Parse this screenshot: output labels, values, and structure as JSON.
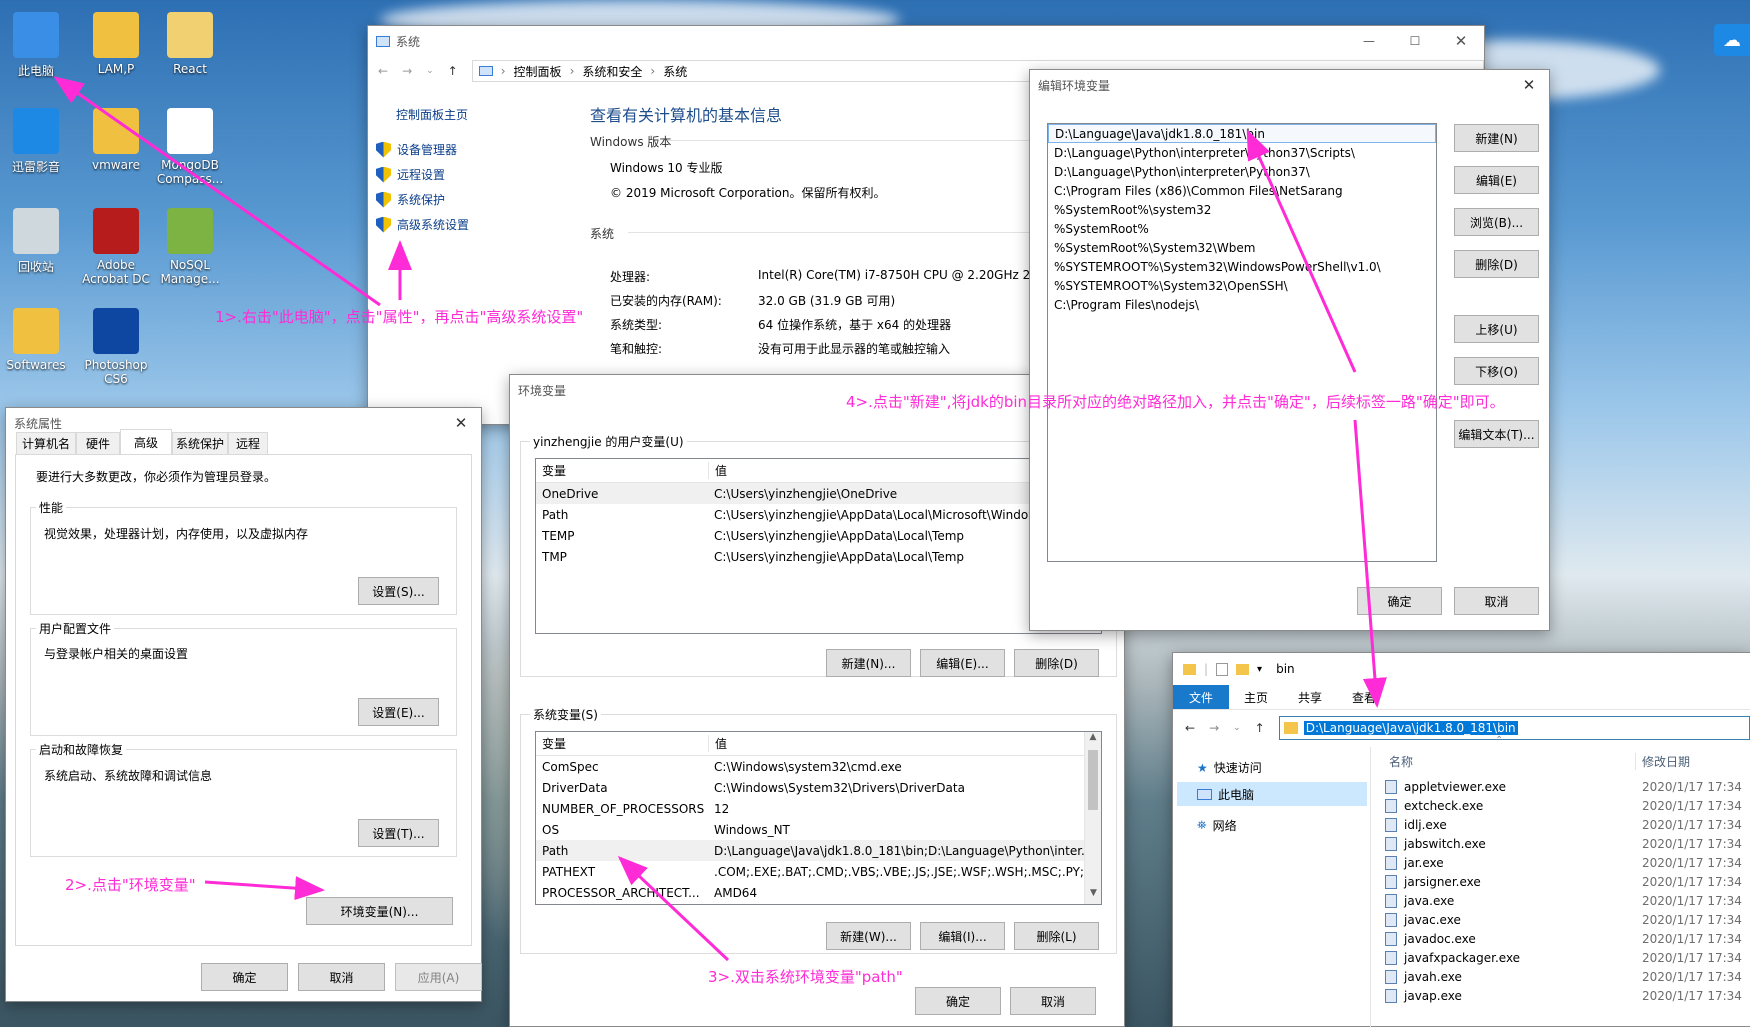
{
  "desktop": {
    "icons": [
      {
        "label": "此电脑",
        "color": "#3a8ee6"
      },
      {
        "label": "LAM,P",
        "color": "#f0c040"
      },
      {
        "label": "React",
        "color": "#f0d070"
      },
      {
        "label": "迅雷影音",
        "color": "#1e88e5"
      },
      {
        "label": "vmware",
        "color": "#f0c040"
      },
      {
        "label": "MongoDB Compass...",
        "color": "#ffffff"
      },
      {
        "label": "回收站",
        "color": "#cfd8dc"
      },
      {
        "label": "Adobe Acrobat DC",
        "color": "#b71c1c"
      },
      {
        "label": "NoSQL Manage...",
        "color": "#7cb342"
      },
      {
        "label": "Softwares",
        "color": "#f0c040"
      },
      {
        "label": "Photoshop CS6",
        "color": "#0d47a1"
      }
    ]
  },
  "system_window": {
    "title": "系统",
    "breadcrumb": [
      "控制面板",
      "系统和安全",
      "系统"
    ],
    "side_title": "控制面板主页",
    "side_links": [
      "设备管理器",
      "远程设置",
      "系统保护",
      "高级系统设置"
    ],
    "heading": "查看有关计算机的基本信息",
    "edition_label": "Windows 版本",
    "edition": "Windows 10 专业版",
    "copyright": "© 2019 Microsoft Corporation。保留所有权利。",
    "system_label": "系统",
    "rows": [
      {
        "k": "处理器:",
        "v": "Intel(R) Core(TM) i7-8750H CPU @ 2.20GHz   2"
      },
      {
        "k": "已安装的内存(RAM):",
        "v": "32.0 GB (31.9 GB 可用)"
      },
      {
        "k": "系统类型:",
        "v": "64 位操作系统，基于 x64 的处理器"
      },
      {
        "k": "笔和触控:",
        "v": "没有可用于此显示器的笔或触控输入"
      }
    ]
  },
  "sysprops": {
    "title": "系统属性",
    "tabs": [
      "计算机名",
      "硬件",
      "高级",
      "系统保护",
      "远程"
    ],
    "admin_note": "要进行大多数更改，你必须作为管理员登录。",
    "perf_label": "性能",
    "perf_desc": "视觉效果，处理器计划，内存使用，以及虚拟内存",
    "perf_btn": "设置(S)...",
    "profile_label": "用户配置文件",
    "profile_desc": "与登录帐户相关的桌面设置",
    "profile_btn": "设置(E)...",
    "startup_label": "启动和故障恢复",
    "startup_desc": "系统启动、系统故障和调试信息",
    "startup_btn": "设置(T)...",
    "env_btn": "环境变量(N)...",
    "ok": "确定",
    "cancel": "取消",
    "apply": "应用(A)"
  },
  "envvars": {
    "title": "环境变量",
    "user_label": "yinzhengjie 的用户变量(U)",
    "col_var": "变量",
    "col_val": "值",
    "user_rows": [
      {
        "k": "OneDrive",
        "v": "C:\\Users\\yinzhengjie\\OneDrive"
      },
      {
        "k": "Path",
        "v": "C:\\Users\\yinzhengjie\\AppData\\Local\\Microsoft\\WindowsApps;"
      },
      {
        "k": "TEMP",
        "v": "C:\\Users\\yinzhengjie\\AppData\\Local\\Temp"
      },
      {
        "k": "TMP",
        "v": "C:\\Users\\yinzhengjie\\AppData\\Local\\Temp"
      }
    ],
    "user_new": "新建(N)...",
    "user_edit": "编辑(E)...",
    "user_del": "删除(D)",
    "sys_label": "系统变量(S)",
    "sys_rows": [
      {
        "k": "ComSpec",
        "v": "C:\\Windows\\system32\\cmd.exe"
      },
      {
        "k": "DriverData",
        "v": "C:\\Windows\\System32\\Drivers\\DriverData"
      },
      {
        "k": "NUMBER_OF_PROCESSORS",
        "v": "12"
      },
      {
        "k": "OS",
        "v": "Windows_NT"
      },
      {
        "k": "Path",
        "v": "D:\\Language\\Java\\jdk1.8.0_181\\bin;D:\\Language\\Python\\inter..."
      },
      {
        "k": "PATHEXT",
        "v": ".COM;.EXE;.BAT;.CMD;.VBS;.VBE;.JS;.JSE;.WSF;.WSH;.MSC;.PY;.P..."
      },
      {
        "k": "PROCESSOR_ARCHITECT...",
        "v": "AMD64"
      }
    ],
    "sys_new": "新建(W)...",
    "sys_edit": "编辑(I)...",
    "sys_del": "删除(L)",
    "ok": "确定",
    "cancel": "取消"
  },
  "editenv": {
    "title": "编辑环境变量",
    "items": [
      "D:\\Language\\Java\\jdk1.8.0_181\\bin",
      "D:\\Language\\Python\\interpreter\\Python37\\Scripts\\",
      "D:\\Language\\Python\\interpreter\\Python37\\",
      "C:\\Program Files (x86)\\Common Files\\NetSarang",
      "%SystemRoot%\\system32",
      "%SystemRoot%",
      "%SystemRoot%\\System32\\Wbem",
      "%SYSTEMROOT%\\System32\\WindowsPowerShell\\v1.0\\",
      "%SYSTEMROOT%\\System32\\OpenSSH\\",
      "C:\\Program Files\\nodejs\\"
    ],
    "btn_new": "新建(N)",
    "btn_edit": "编辑(E)",
    "btn_browse": "浏览(B)...",
    "btn_delete": "删除(D)",
    "btn_up": "上移(U)",
    "btn_down": "下移(O)",
    "btn_text": "编辑文本(T)...",
    "ok": "确定",
    "cancel": "取消"
  },
  "explorer": {
    "title": "bin",
    "ribbon_tabs": [
      "文件",
      "主页",
      "共享",
      "查看"
    ],
    "address": "D:\\Language\\Java\\jdk1.8.0_181\\bin",
    "nav": [
      "快速访问",
      "此电脑",
      "网络"
    ],
    "col_name": "名称",
    "col_date": "修改日期",
    "files": [
      {
        "name": "appletviewer.exe",
        "date": "2020/1/17 17:34"
      },
      {
        "name": "extcheck.exe",
        "date": "2020/1/17 17:34"
      },
      {
        "name": "idlj.exe",
        "date": "2020/1/17 17:34"
      },
      {
        "name": "jabswitch.exe",
        "date": "2020/1/17 17:34"
      },
      {
        "name": "jar.exe",
        "date": "2020/1/17 17:34"
      },
      {
        "name": "jarsigner.exe",
        "date": "2020/1/17 17:34"
      },
      {
        "name": "java.exe",
        "date": "2020/1/17 17:34"
      },
      {
        "name": "javac.exe",
        "date": "2020/1/17 17:34"
      },
      {
        "name": "javadoc.exe",
        "date": "2020/1/17 17:34"
      },
      {
        "name": "javafxpackager.exe",
        "date": "2020/1/17 17:34"
      },
      {
        "name": "javah.exe",
        "date": "2020/1/17 17:34"
      },
      {
        "name": "javap.exe",
        "date": "2020/1/17 17:34"
      }
    ]
  },
  "annotations": {
    "step1": "1>.右击\"此电脑\"，点击\"属性\"，再点击\"高级系统设置\"",
    "step2": "2>.点击\"环境变量\"",
    "step3": "3>.双击系统环境变量\"path\"",
    "step4": "4>.点击\"新建\",将jdk的bin目录所对应的绝对路径加入，并点击\"确定\"，后续标签一路\"确定\"即可。",
    "color": "#ff2bd6"
  }
}
